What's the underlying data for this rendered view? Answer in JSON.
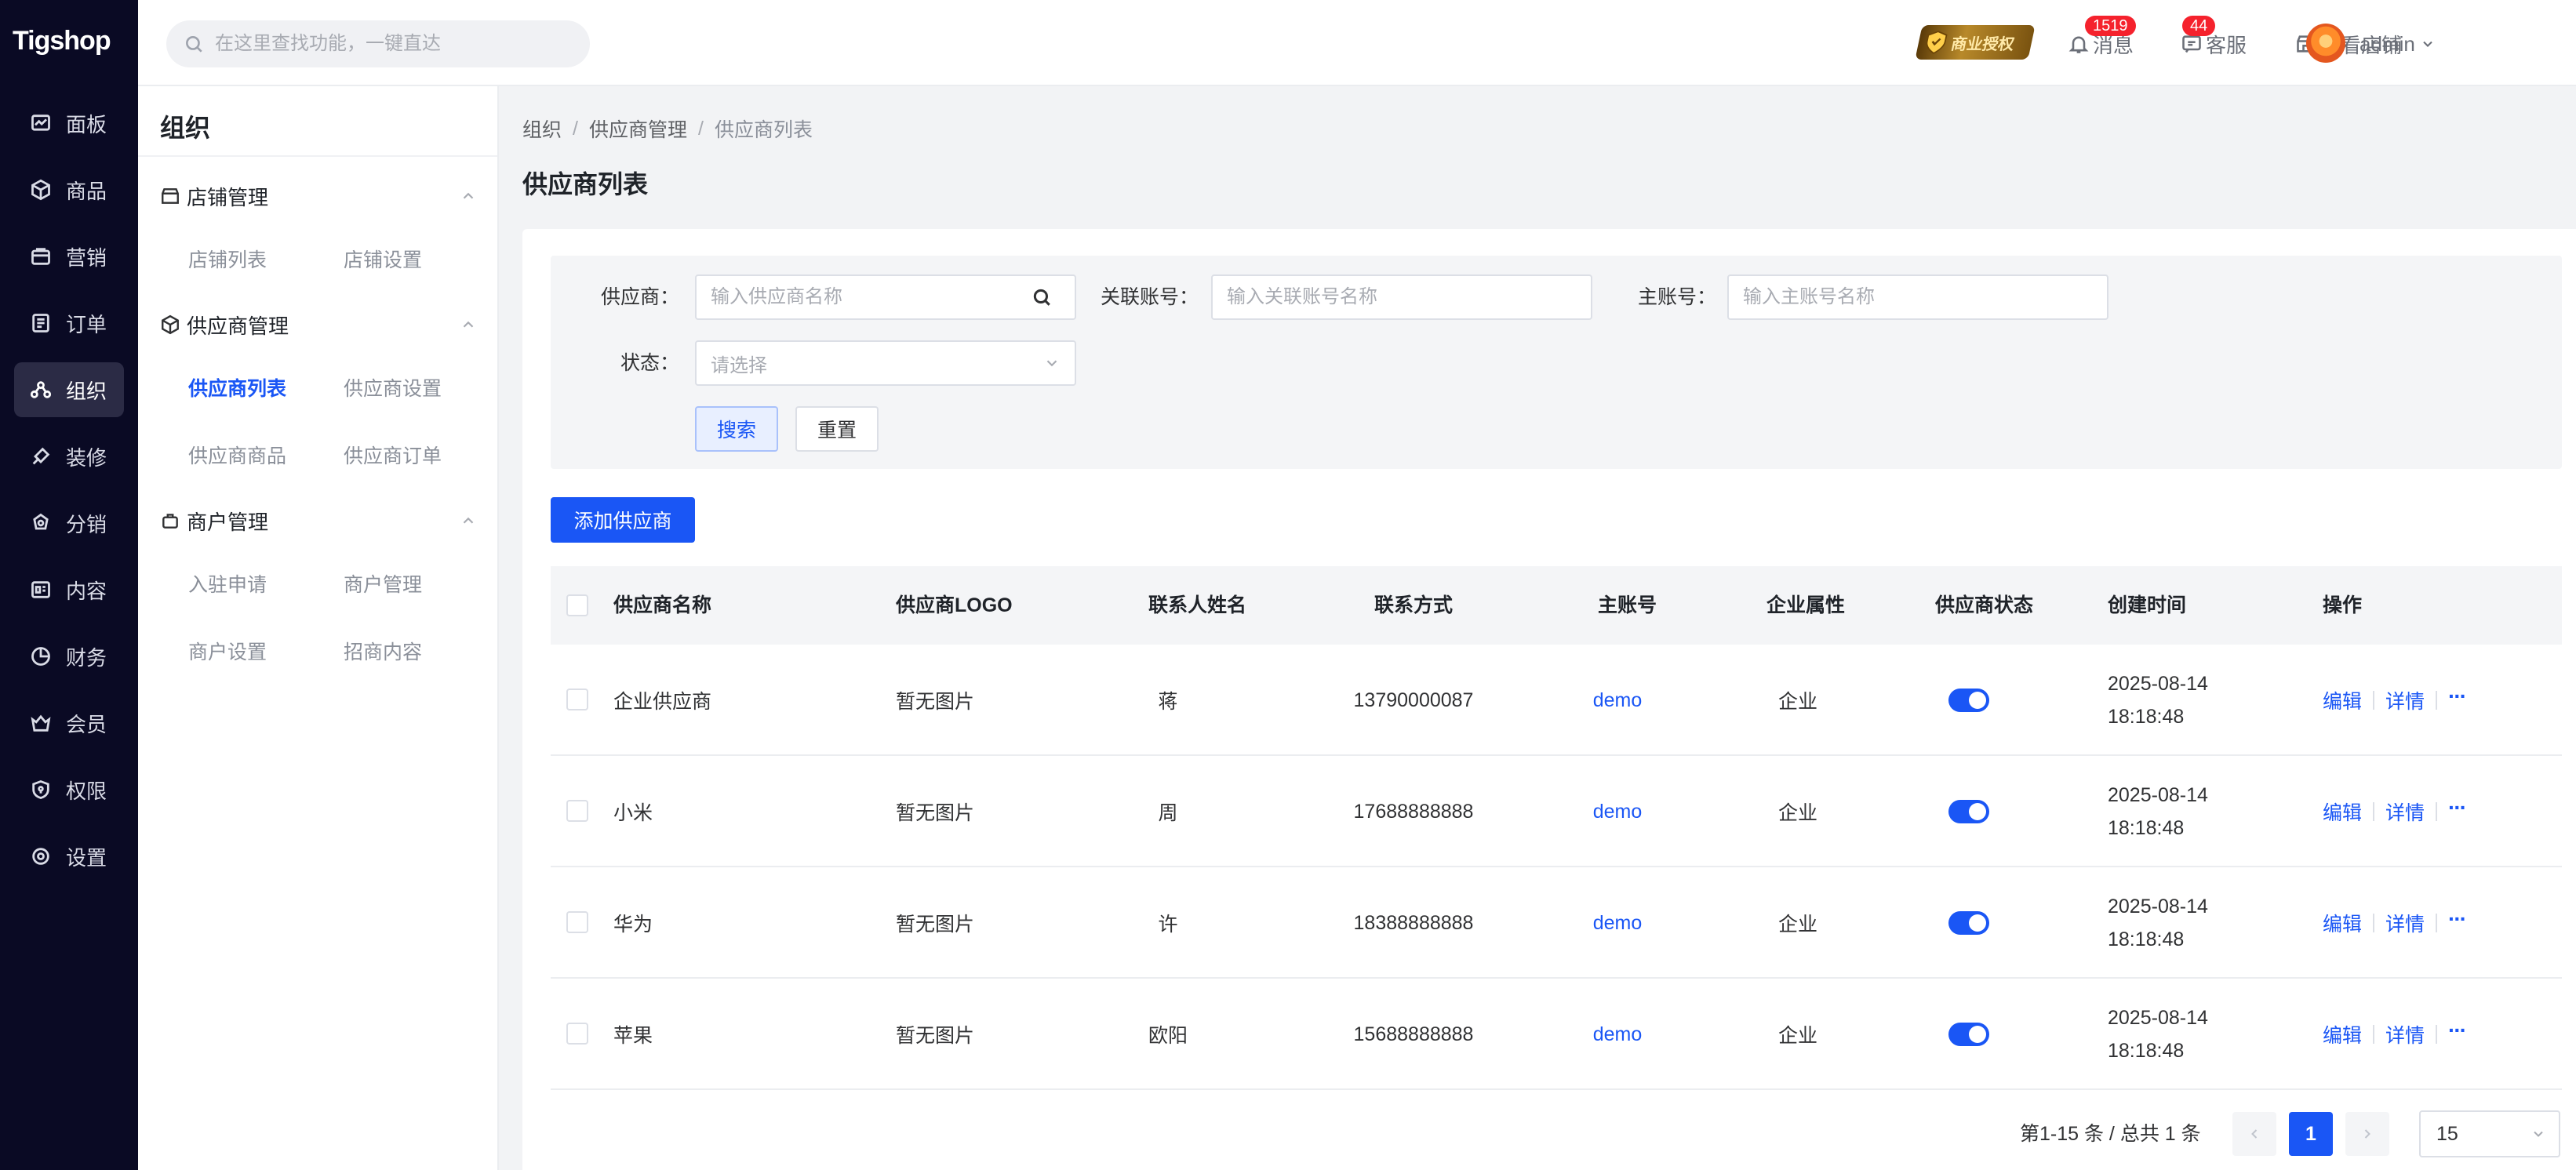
{
  "app": {
    "logo": "Tigshop"
  },
  "nav": [
    {
      "label": "面板",
      "icon": "dashboard-icon"
    },
    {
      "label": "商品",
      "icon": "box-icon"
    },
    {
      "label": "营销",
      "icon": "marketing-icon"
    },
    {
      "label": "订单",
      "icon": "order-icon"
    },
    {
      "label": "组织",
      "icon": "org-icon",
      "active": true
    },
    {
      "label": "装修",
      "icon": "brush-icon"
    },
    {
      "label": "分销",
      "icon": "distribution-icon"
    },
    {
      "label": "内容",
      "icon": "content-icon"
    },
    {
      "label": "财务",
      "icon": "finance-icon"
    },
    {
      "label": "会员",
      "icon": "member-icon"
    },
    {
      "label": "权限",
      "icon": "permission-icon"
    },
    {
      "label": "设置",
      "icon": "settings-icon"
    }
  ],
  "header": {
    "search_placeholder": "在这里查找功能，一键直达",
    "license": "商业授权",
    "messages": {
      "label": "消息",
      "badge": "1519"
    },
    "service": {
      "label": "客服",
      "badge": "44"
    },
    "view_store": "查看店铺",
    "user": "admin"
  },
  "submenu": {
    "title": "组织",
    "groups": [
      {
        "title": "店铺管理",
        "items": [
          "店铺列表",
          "店铺设置"
        ]
      },
      {
        "title": "供应商管理",
        "items": [
          "供应商列表",
          "供应商设置",
          "供应商商品",
          "供应商订单"
        ]
      },
      {
        "title": "商户管理",
        "items": [
          "入驻申请",
          "商户管理",
          "商户设置",
          "招商内容"
        ]
      }
    ],
    "active_item": "供应商列表"
  },
  "breadcrumb": [
    "组织",
    "供应商管理",
    "供应商列表"
  ],
  "breadcrumb_sep": "/",
  "page_title": "供应商列表",
  "filter": {
    "supplier_label": "供应商：",
    "supplier_placeholder": "输入供应商名称",
    "linked_label": "关联账号：",
    "linked_placeholder": "输入关联账号名称",
    "main_label": "主账号：",
    "main_placeholder": "输入主账号名称",
    "status_label": "状态：",
    "status_placeholder": "请选择",
    "search_button": "搜索",
    "reset_button": "重置"
  },
  "add_button": "添加供应商",
  "table": {
    "columns": [
      "供应商名称",
      "供应商LOGO",
      "联系人姓名",
      "联系方式",
      "主账号",
      "企业属性",
      "供应商状态",
      "创建时间",
      "操作"
    ],
    "rows": [
      {
        "name": "企业供应商",
        "logo": "暂无图片",
        "contact": "蒋",
        "phone": "13790000087",
        "account": "demo",
        "type": "企业",
        "enabled": true,
        "date": "2025-08-14",
        "time": "18:18:48"
      },
      {
        "name": "小米",
        "logo": "暂无图片",
        "contact": "周",
        "phone": "17688888888",
        "account": "demo",
        "type": "企业",
        "enabled": true,
        "date": "2025-08-14",
        "time": "18:18:48"
      },
      {
        "name": "华为",
        "logo": "暂无图片",
        "contact": "许",
        "phone": "18388888888",
        "account": "demo",
        "type": "企业",
        "enabled": true,
        "date": "2025-08-14",
        "time": "18:18:48"
      },
      {
        "name": "苹果",
        "logo": "暂无图片",
        "contact": "欧阳",
        "phone": "15688888888",
        "account": "demo",
        "type": "企业",
        "enabled": true,
        "date": "2025-08-14",
        "time": "18:18:48"
      }
    ],
    "actions": {
      "edit": "编辑",
      "detail": "详情",
      "more": "···"
    }
  },
  "pagination": {
    "summary": "第1-15 条 / 总共 1 条",
    "current_page": "1",
    "page_size": "15"
  },
  "colors": {
    "primary": "#1a56f5",
    "nav_bg": "#0a0a24",
    "badge": "#f5222d"
  }
}
